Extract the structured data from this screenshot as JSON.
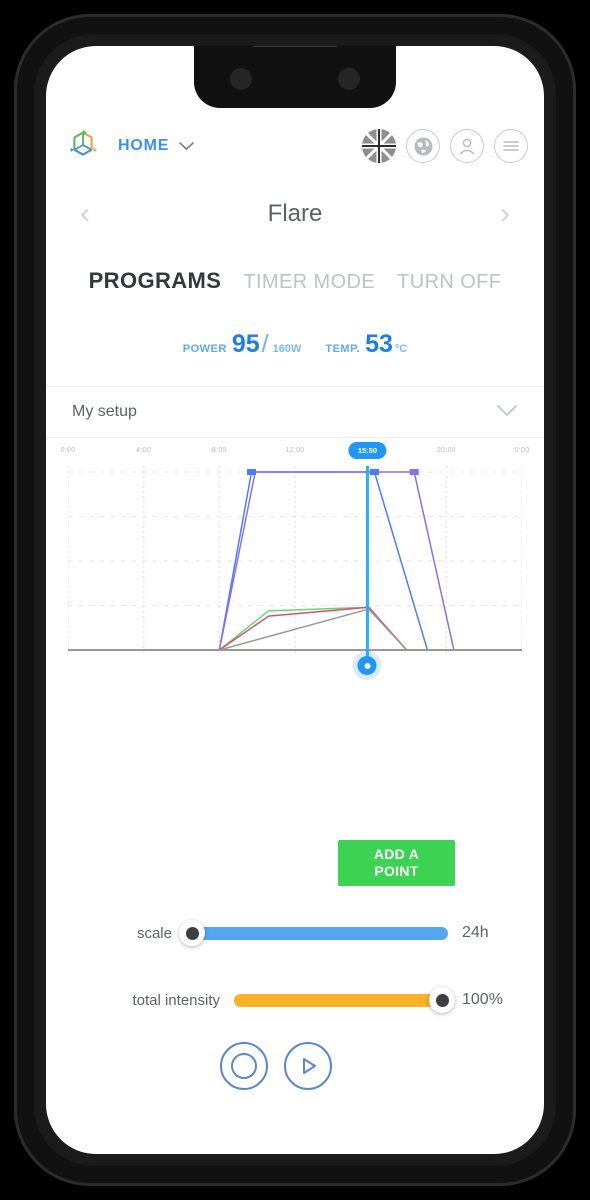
{
  "header": {
    "logo_icon": "cube-axes-logo-icon",
    "home_label": "HOME",
    "home_caret": "⌄",
    "icons": [
      {
        "name": "uk-flag-icon",
        "label": "UK"
      },
      {
        "name": "globe-icon",
        "label": "🌐"
      },
      {
        "name": "user-profile-icon",
        "label": "○"
      },
      {
        "name": "hamburger-menu-icon",
        "label": "☰"
      }
    ]
  },
  "titlebar": {
    "prev_arrow": "‹",
    "title": "Flare",
    "next_arrow": "›"
  },
  "tabs": [
    {
      "label": "PROGRAMS",
      "active": true
    },
    {
      "label": "TIMER MODE",
      "active": false
    },
    {
      "label": "TURN OFF",
      "active": false
    }
  ],
  "readouts": {
    "power": {
      "label": "POWER",
      "value": "95",
      "separator": "/",
      "max": "160W"
    },
    "temp": {
      "label": "TEMP.",
      "value": "53",
      "unit": "°C"
    }
  },
  "setup": {
    "label": "My setup",
    "caret": "⌄"
  },
  "chart_data": {
    "type": "line",
    "title": "",
    "xlabel": "",
    "ylabel": "",
    "grid": true,
    "legend": "none",
    "x": [
      0,
      4,
      8,
      12,
      16,
      20,
      24
    ],
    "tick_labels": [
      "0:00",
      "4:00",
      "8:00",
      "12:00",
      "16:00",
      "20:00",
      "0:00"
    ],
    "xlim": [
      0,
      24
    ],
    "ylim": [
      0,
      100
    ],
    "cursor": {
      "label": "15:50",
      "x": 15.83
    },
    "series": [
      {
        "name": "channel-blue",
        "color": "#4a7dfd",
        "points": [
          [
            0,
            0
          ],
          [
            8.0,
            0
          ],
          [
            9.7,
            100
          ],
          [
            16.2,
            100
          ],
          [
            19.0,
            0
          ],
          [
            20.2,
            0
          ],
          [
            24,
            0
          ]
        ]
      },
      {
        "name": "channel-violet",
        "color": "#8b6fe8",
        "points": [
          [
            0,
            0
          ],
          [
            8.0,
            0
          ],
          [
            9.9,
            100
          ],
          [
            18.3,
            100
          ],
          [
            20.4,
            0
          ],
          [
            24,
            0
          ]
        ]
      },
      {
        "name": "channel-green",
        "color": "#63d878",
        "points": [
          [
            0,
            0
          ],
          [
            8.0,
            0
          ],
          [
            10.6,
            22
          ],
          [
            15.9,
            24
          ],
          [
            17.9,
            0
          ],
          [
            24,
            0
          ]
        ]
      },
      {
        "name": "channel-red",
        "color": "#d8536a",
        "points": [
          [
            0,
            0
          ],
          [
            8.0,
            0
          ],
          [
            10.6,
            19
          ],
          [
            15.9,
            24
          ],
          [
            17.9,
            0
          ],
          [
            24,
            0
          ]
        ]
      },
      {
        "name": "channel-gray",
        "color": "#9b968f",
        "points": [
          [
            0,
            0
          ],
          [
            8.0,
            0
          ],
          [
            15.9,
            23
          ],
          [
            17.9,
            0
          ],
          [
            24,
            0
          ]
        ]
      }
    ],
    "markers": [
      {
        "x": 9.7,
        "y": 100,
        "color": "#4a7dfd"
      },
      {
        "x": 16.2,
        "y": 100,
        "color": "#4a7dfd"
      },
      {
        "x": 18.3,
        "y": 100,
        "color": "#8b6fe8"
      }
    ]
  },
  "add_point_button": {
    "line1": "ADD A",
    "line2": "POINT",
    "color": "#3ed252"
  },
  "sliders": [
    {
      "name": "scale",
      "label": "scale",
      "value": "24h",
      "color": "#53a6f2",
      "knob_position": "left"
    },
    {
      "name": "total-intensity",
      "label": "total intensity",
      "value": "100%",
      "color": "#f9b229",
      "knob_position": "right"
    }
  ],
  "bottom_controls": [
    {
      "name": "stop-button",
      "icon": "stop-circle-icon"
    },
    {
      "name": "play-button",
      "icon": "play-icon"
    }
  ]
}
